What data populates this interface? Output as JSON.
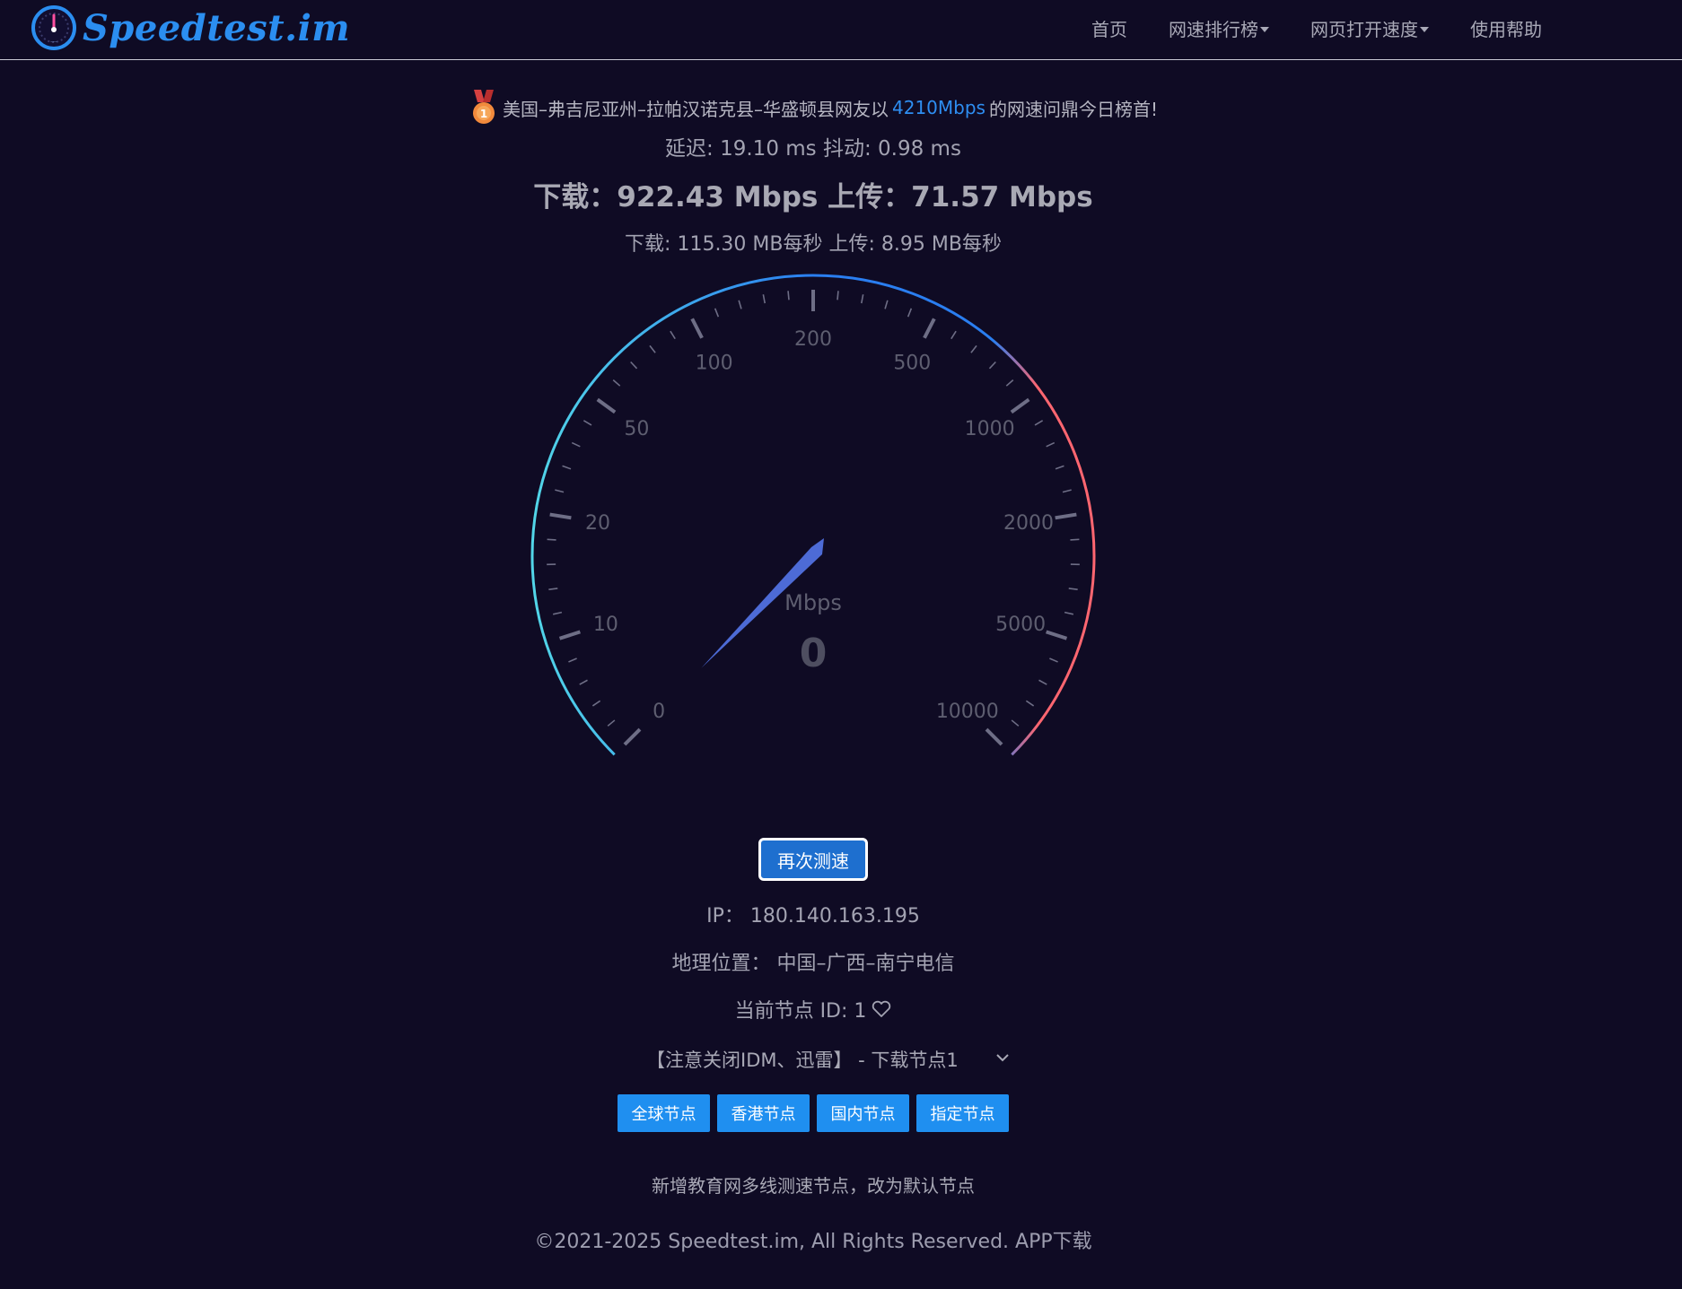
{
  "brand": {
    "logo_text": "Speedtest.im",
    "accent": "#2b8ef0"
  },
  "nav": {
    "items": [
      {
        "label": "首页",
        "dropdown": false
      },
      {
        "label": "网速排行榜",
        "dropdown": true
      },
      {
        "label": "网页打开速度",
        "dropdown": true
      },
      {
        "label": "使用帮助",
        "dropdown": false
      }
    ]
  },
  "champion": {
    "prefix": "美国–弗吉尼亚州–拉帕汉诺克县–华盛顿县网友以",
    "speed": "4210Mbps",
    "suffix": "的网速问鼎今日榜首!",
    "icon": "medal-icon"
  },
  "latency_line": "延迟: 19.10 ms 抖动: 0.98 ms",
  "speed_line": "下载：922.43 Mbps 上传：71.57 Mbps",
  "mbsec_line": "下载: 115.30 MB每秒 上传: 8.95 MB每秒",
  "gauge": {
    "unit": "Mbps",
    "current_value": "0",
    "scale_labels": [
      "0",
      "10",
      "20",
      "50",
      "100",
      "200",
      "500",
      "1000",
      "2000",
      "5000",
      "10000"
    ],
    "needle_label_position": 4.95,
    "colors": {
      "arc_start": "#52d6e8",
      "arc_mid": "#2a7ef0",
      "arc_end": "#ff6670",
      "needle": "#4d6bd6",
      "tick": "#6e6e86",
      "label": "#5e5e70",
      "value": "#4e4e60"
    }
  },
  "retest_label": "再次测速",
  "ip_line": "IP：  180.140.163.195",
  "geo_line": "地理位置：  中国–广西–南宁电信",
  "node_line": "当前节点 ID: 1",
  "node_select": {
    "value": "【注意关闭IDM、迅雷】 - 下载节点1"
  },
  "node_buttons": [
    "全球节点",
    "香港节点",
    "国内节点",
    "指定节点"
  ],
  "notice": "新增教育网多线测速节点，改为默认节点",
  "footer": {
    "copyright": "©2021-2025 Speedtest.im, All Rights Reserved. ",
    "app_link": "APP下载"
  }
}
